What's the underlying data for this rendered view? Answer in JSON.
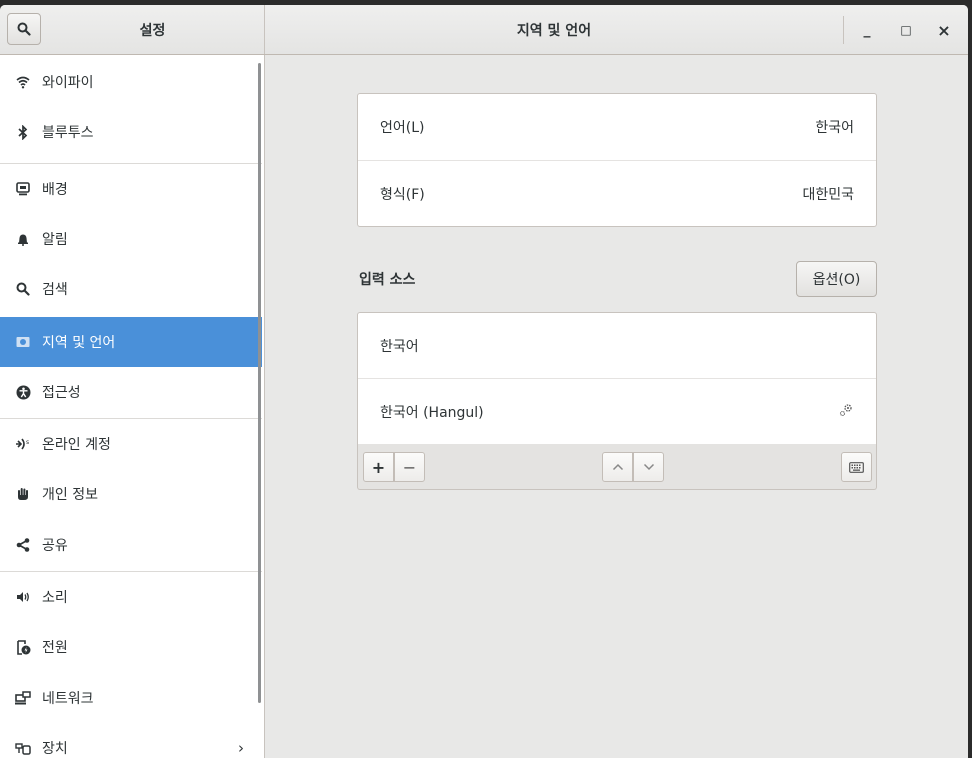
{
  "header": {
    "sidebar_title": "설정",
    "title": "지역 및 언어",
    "minimize": "_",
    "maximize": "□",
    "close": "×"
  },
  "sidebar": {
    "items": [
      {
        "label": "와이파이",
        "icon": "wifi-icon"
      },
      {
        "label": "블루투스",
        "icon": "bluetooth-icon"
      },
      {
        "label": "배경",
        "icon": "background-icon"
      },
      {
        "label": "알림",
        "icon": "bell-icon"
      },
      {
        "label": "검색",
        "icon": "search-icon"
      },
      {
        "label": "지역 및 언어",
        "icon": "region-icon",
        "selected": true
      },
      {
        "label": "접근성",
        "icon": "accessibility-icon"
      },
      {
        "label": "온라인 계정",
        "icon": "online-accounts-icon"
      },
      {
        "label": "개인 정보",
        "icon": "privacy-hand-icon"
      },
      {
        "label": "공유",
        "icon": "share-icon"
      },
      {
        "label": "소리",
        "icon": "speaker-icon"
      },
      {
        "label": "전원",
        "icon": "power-icon"
      },
      {
        "label": "네트워크",
        "icon": "network-icon"
      },
      {
        "label": "장치",
        "icon": "devices-icon",
        "chevron": "›"
      }
    ]
  },
  "main": {
    "language": {
      "label": "언어(L)",
      "value": "한국어"
    },
    "formats": {
      "label": "형식(F)",
      "value": "대한민국"
    },
    "input_sources_label": "입력 소스",
    "options_button": "옵션(O)",
    "sources": [
      "한국어",
      "한국어 (Hangul)"
    ],
    "toolbar": {
      "add": "+",
      "remove": "−"
    }
  },
  "colors": {
    "accent": "#4a90d9"
  }
}
